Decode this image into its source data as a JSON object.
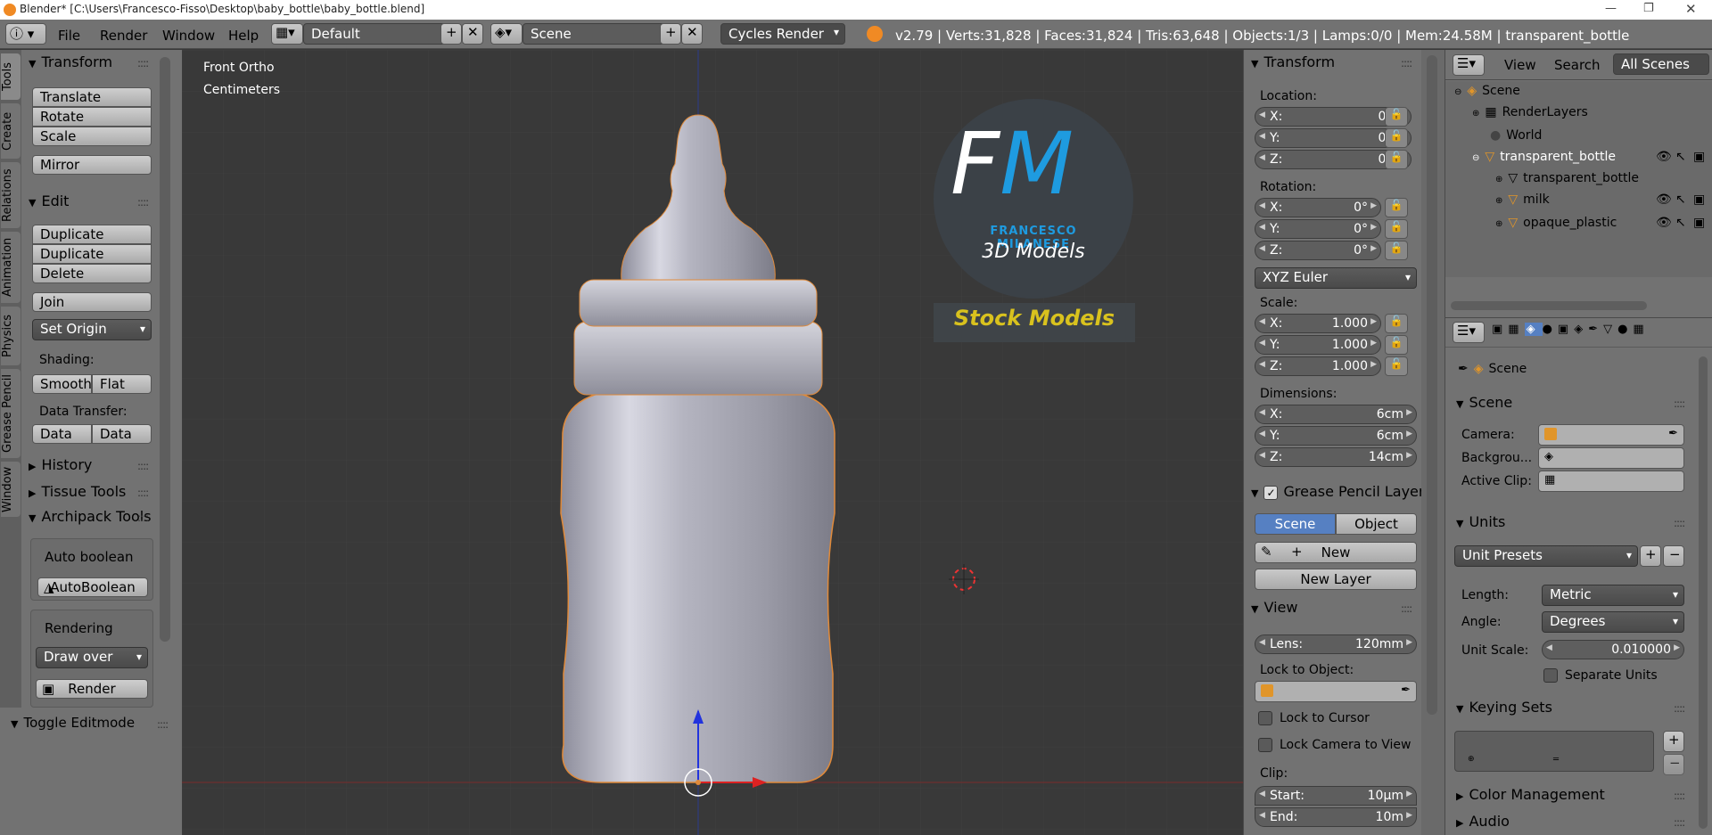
{
  "window": {
    "title": "Blender* [C:\\Users\\Francesco-Fisso\\Desktop\\baby_bottle\\baby_bottle.blend]"
  },
  "menu": {
    "file": "File",
    "render": "Render",
    "window": "Window",
    "help": "Help"
  },
  "header": {
    "layout": "Default",
    "scene": "Scene",
    "engine": "Cycles Render",
    "stats": "v2.79 | Verts:31,828 | Faces:31,824 | Tris:63,648 | Objects:1/3 | Lamps:0/0 | Mem:24.58M | transparent_bottle"
  },
  "tabs": [
    "Tools",
    "Create",
    "Relations",
    "Animation",
    "Physics",
    "Grease Pencil",
    "Window"
  ],
  "toolshelf": {
    "transform": {
      "title": "Transform",
      "translate": "Translate",
      "rotate": "Rotate",
      "scale": "Scale",
      "mirror": "Mirror"
    },
    "edit": {
      "title": "Edit",
      "duplicate": "Duplicate",
      "duplicate_linked": "Duplicate Linked",
      "delete": "Delete",
      "join": "Join",
      "set_origin": "Set Origin",
      "shading": "Shading:",
      "smooth": "Smooth",
      "flat": "Flat",
      "data_transfer": "Data Transfer:",
      "data": "Data",
      "data_la": "Data La"
    },
    "history": "History",
    "tissue": "Tissue Tools",
    "archipack": "Archipack Tools",
    "auto_boolean": "Auto boolean",
    "autoboolean_btn": "AutoBoolean",
    "rendering": "Rendering",
    "draw_over": "Draw over",
    "render": "Render",
    "toggle_editmode": "Toggle Editmode"
  },
  "viewport": {
    "view": "Front Ortho",
    "units": "Centimeters",
    "logo_initials": "FM",
    "logo_name": "FRANCESCO MILANESE",
    "logo_sub": "3D Models",
    "stock": "Stock Models"
  },
  "npanel": {
    "transform": "Transform",
    "location": "Location:",
    "rotation": "Rotation:",
    "scale": "Scale:",
    "dimensions": "Dimensions:",
    "loc": {
      "x": "0m",
      "y": "0m",
      "z": "0m"
    },
    "rot": {
      "x": "0°",
      "y": "0°",
      "z": "0°"
    },
    "euler": "XYZ Euler",
    "scl": {
      "x": "1.000",
      "y": "1.000",
      "z": "1.000"
    },
    "dim": {
      "x": "6cm",
      "y": "6cm",
      "z": "14cm"
    },
    "xl": "X:",
    "yl": "Y:",
    "zl": "Z:",
    "grease": "Grease Pencil Layer",
    "gp_scene": "Scene",
    "gp_object": "Object",
    "gp_new": "New",
    "gp_new_layer": "New Layer",
    "view": "View",
    "lens_l": "Lens:",
    "lens_v": "120mm",
    "lock_obj": "Lock to Object:",
    "lock_cursor": "Lock to Cursor",
    "lock_camera": "Lock Camera to View",
    "clip": "Clip:",
    "start_l": "Start:",
    "start_v": "10µm",
    "end_l": "End:",
    "end_v": "10m"
  },
  "outliner": {
    "view": "View",
    "search": "Search",
    "all_scenes": "All Scenes",
    "items": [
      "Scene",
      "RenderLayers",
      "World",
      "transparent_bottle",
      "transparent_bottle",
      "milk",
      "opaque_plastic"
    ]
  },
  "properties": {
    "crumb": "Scene",
    "scene": "Scene",
    "camera": "Camera:",
    "background": "Backgrou...",
    "active_clip": "Active Clip:",
    "units": "Units",
    "unit_presets": "Unit Presets",
    "length_l": "Length:",
    "length_v": "Metric",
    "angle_l": "Angle:",
    "angle_v": "Degrees",
    "unit_scale_l": "Unit Scale:",
    "unit_scale_v": "0.010000",
    "separate_units": "Separate Units",
    "keying_sets": "Keying Sets",
    "color_management": "Color Management",
    "audio": "Audio"
  },
  "colors": {
    "panel": "#727272",
    "viewport": "#393939",
    "selected": "#5680c2",
    "logo_blue": "#1e9be0",
    "stock": "#d9c21e"
  }
}
